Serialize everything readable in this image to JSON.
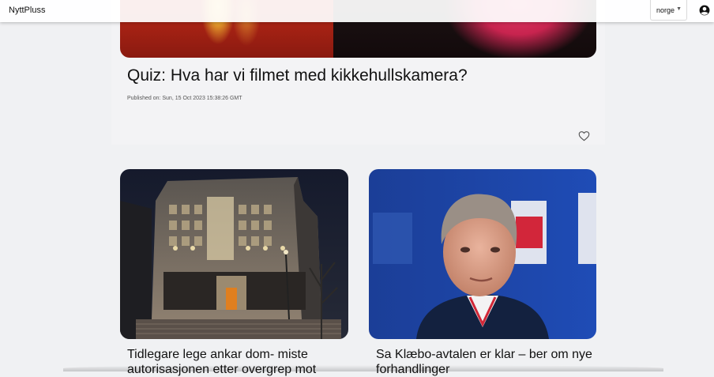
{
  "header": {
    "brand": "NyttPluss",
    "region": {
      "selected": "norge"
    },
    "icons": {
      "caret": "caret-down-icon",
      "account": "account-circle-icon"
    }
  },
  "hero": {
    "title": "Quiz: Hva har vi filmet med kikkehullskamera?",
    "published": "Published on: Sun, 15 Oct 2023 15:38:26 GMT",
    "icons": {
      "favorite": "heart-outline-icon"
    }
  },
  "articles": [
    {
      "title": "Tidlegare lege ankar dom- miste autorisasjonen etter overgrep mot"
    },
    {
      "title": "Sa Klæbo-avtalen er klar – ber om nye forhandlinger"
    }
  ]
}
